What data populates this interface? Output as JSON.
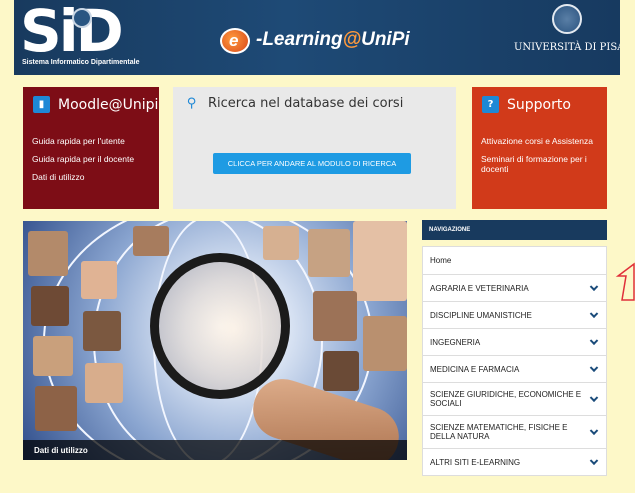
{
  "header": {
    "logo_text": "SiD",
    "logo_subtitle": "Sistema Informatico Dipartimentale",
    "elearning_letter": "e",
    "elearning_prefix": "-Learning",
    "elearning_at": "@",
    "elearning_suffix": "UniPi",
    "university": "UNIVERSITÀ DI PISA"
  },
  "moodle": {
    "title": "Moodle@Unipi",
    "links": [
      "Guida rapida per l'utente",
      "Guida rapida per il docente",
      "Dati di utilizzo"
    ]
  },
  "search": {
    "title": "Ricerca nel database dei corsi",
    "button": "CLICCA PER ANDARE AL MODULO DI RICERCA"
  },
  "support": {
    "title": "Supporto",
    "links": [
      "Attivazione corsi e Assistenza",
      "Seminari di formazione per i docenti"
    ]
  },
  "hero": {
    "caption": "Dati di utilizzo"
  },
  "nav": {
    "header": "NAVIGAZIONE",
    "home": "Home",
    "items": [
      "AGRARIA E VETERINARIA",
      "DISCIPLINE UMANISTICHE",
      "INGEGNERIA",
      "MEDICINA E FARMACIA",
      "SCIENZE GIURIDICHE, ECONOMICHE E SOCIALI",
      "SCIENZE MATEMATICHE, FISICHE E DELLA NATURA",
      "ALTRI SITI E-LEARNING"
    ]
  },
  "colors": {
    "header_bg": "#183a5e",
    "moodle_bg": "#7d0d16",
    "support_bg": "#d13a1a",
    "accent_blue": "#1e9be3",
    "page_bg": "#fdf8c8"
  },
  "icons": {
    "moodle": "book-icon",
    "search": "search-icon",
    "support": "question-icon",
    "nav_item": "chevron-down-icon"
  }
}
